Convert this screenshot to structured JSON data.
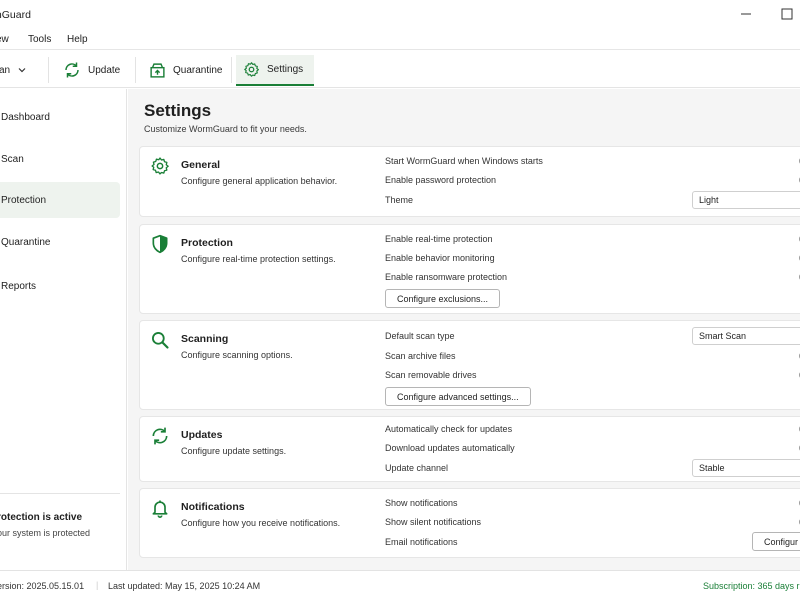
{
  "app": {
    "title": "mGuard"
  },
  "menu": {
    "items": [
      "ew",
      "Tools",
      "Help"
    ]
  },
  "toolbar": {
    "scan_label": "can",
    "update_label": "Update",
    "quarantine_label": "Quarantine",
    "settings_label": "Settings",
    "active": "settings"
  },
  "sidebar": {
    "items": [
      {
        "label": "Dashboard",
        "active": false
      },
      {
        "label": "Scan",
        "active": false
      },
      {
        "label": "Protection",
        "active": true
      },
      {
        "label": "Quarantine",
        "active": false
      },
      {
        "label": "Reports",
        "active": false
      }
    ],
    "protection_status": {
      "title": "rotection is active",
      "subtitle": "our system is protected"
    }
  },
  "page": {
    "title": "Settings",
    "subtitle": "Customize WormGuard to fit your needs."
  },
  "sections": {
    "general": {
      "icon": "gear-icon",
      "title": "General",
      "description": "Configure general application behavior.",
      "options": [
        "Start WormGuard when Windows starts",
        "Enable password protection",
        "Theme"
      ],
      "theme_value": "Light"
    },
    "protection": {
      "icon": "shield-icon",
      "title": "Protection",
      "description": "Configure real-time protection settings.",
      "options": [
        "Enable real-time protection",
        "Enable behavior monitoring",
        "Enable ransomware protection"
      ],
      "button": "Configure exclusions..."
    },
    "scanning": {
      "icon": "search-icon",
      "title": "Scanning",
      "description": "Configure scanning options.",
      "options": [
        "Default scan type",
        "Scan archive files",
        "Scan removable drives"
      ],
      "scan_type_value": "Smart Scan",
      "button": "Configure advanced settings..."
    },
    "updates": {
      "icon": "refresh-icon",
      "title": "Updates",
      "description": "Configure update settings.",
      "options": [
        "Automatically check for updates",
        "Download updates automatically",
        "Update channel"
      ],
      "channel_value": "Stable"
    },
    "notifications": {
      "icon": "bell-icon",
      "title": "Notifications",
      "description": "Configure how you receive notifications.",
      "options": [
        "Show notifications",
        "Show silent notifications",
        "Email notifications"
      ],
      "button": "Configur"
    }
  },
  "status": {
    "version": "ersion: 2025.05.15.01",
    "last_updated": "Last updated: May 15, 2025 10:24 AM",
    "subscription": "Subscription: 365 days r"
  },
  "colors": {
    "accent": "#1a7f37",
    "main_bg": "#f5f5f5",
    "active_bg": "#eef3ee"
  }
}
